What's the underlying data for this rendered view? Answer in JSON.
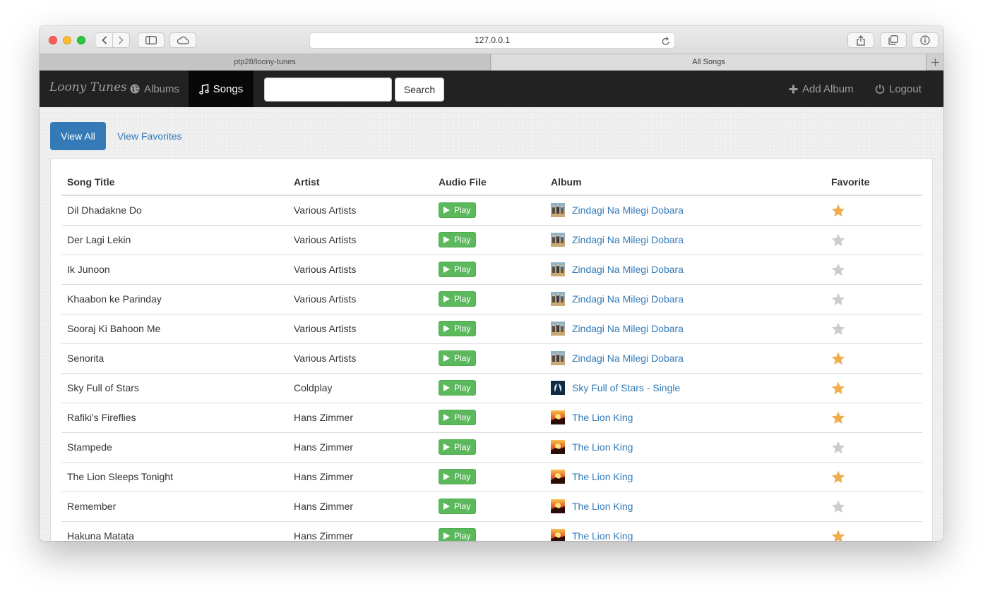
{
  "browser": {
    "url": "127.0.0.1",
    "tabs": [
      {
        "label": "ptp28/loony-tunes"
      },
      {
        "label": "All Songs"
      }
    ]
  },
  "navbar": {
    "brand": "Loony Tunes",
    "albums_label": "Albums",
    "songs_label": "Songs",
    "search_value": "",
    "search_button": "Search",
    "add_album_label": "Add Album",
    "logout_label": "Logout"
  },
  "filters": {
    "view_all": "View All",
    "view_favorites": "View Favorites"
  },
  "table": {
    "headers": {
      "title": "Song Title",
      "artist": "Artist",
      "audio": "Audio File",
      "album": "Album",
      "favorite": "Favorite"
    },
    "play_label": "Play",
    "rows": [
      {
        "title": "Dil Dhadakne Do",
        "artist": "Various Artists",
        "album": "Zindagi Na Milegi Dobara",
        "cover": "znmd",
        "favorite": true
      },
      {
        "title": "Der Lagi Lekin",
        "artist": "Various Artists",
        "album": "Zindagi Na Milegi Dobara",
        "cover": "znmd",
        "favorite": false
      },
      {
        "title": "Ik Junoon",
        "artist": "Various Artists",
        "album": "Zindagi Na Milegi Dobara",
        "cover": "znmd",
        "favorite": false
      },
      {
        "title": "Khaabon ke Parinday",
        "artist": "Various Artists",
        "album": "Zindagi Na Milegi Dobara",
        "cover": "znmd",
        "favorite": false
      },
      {
        "title": "Sooraj Ki Bahoon Me",
        "artist": "Various Artists",
        "album": "Zindagi Na Milegi Dobara",
        "cover": "znmd",
        "favorite": false
      },
      {
        "title": "Senorita",
        "artist": "Various Artists",
        "album": "Zindagi Na Milegi Dobara",
        "cover": "znmd",
        "favorite": true
      },
      {
        "title": "Sky Full of Stars",
        "artist": "Coldplay",
        "album": "Sky Full of Stars - Single",
        "cover": "coldplay",
        "favorite": true
      },
      {
        "title": "Rafiki's Fireflies",
        "artist": "Hans Zimmer",
        "album": "The Lion King",
        "cover": "lionking",
        "favorite": true
      },
      {
        "title": "Stampede",
        "artist": "Hans Zimmer",
        "album": "The Lion King",
        "cover": "lionking",
        "favorite": false
      },
      {
        "title": "The Lion Sleeps Tonight",
        "artist": "Hans Zimmer",
        "album": "The Lion King",
        "cover": "lionking",
        "favorite": true
      },
      {
        "title": "Remember",
        "artist": "Hans Zimmer",
        "album": "The Lion King",
        "cover": "lionking",
        "favorite": false
      },
      {
        "title": "Hakuna Matata",
        "artist": "Hans Zimmer",
        "album": "The Lion King",
        "cover": "lionking",
        "favorite": true
      }
    ]
  },
  "colors": {
    "navbar_bg": "#222222",
    "link": "#337ab7",
    "play_button": "#5cb85c",
    "star_on": "#f0ad4e",
    "star_off": "#cccccc"
  }
}
